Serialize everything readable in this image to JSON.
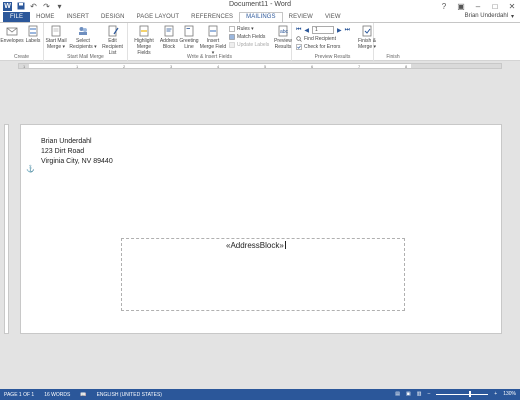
{
  "window": {
    "title": "Document11 - Word",
    "controls": [
      "?",
      "▣",
      "–",
      "□",
      "✕"
    ]
  },
  "qat": {
    "logo": "W",
    "save_icon": "▪",
    "undo_icon": "↶",
    "redo_icon": "↷",
    "more_icon": "▾"
  },
  "tabs": [
    {
      "label": "FILE",
      "kind": "file"
    },
    {
      "label": "HOME",
      "kind": ""
    },
    {
      "label": "INSERT",
      "kind": ""
    },
    {
      "label": "DESIGN",
      "kind": ""
    },
    {
      "label": "PAGE LAYOUT",
      "kind": ""
    },
    {
      "label": "REFERENCES",
      "kind": ""
    },
    {
      "label": "MAILINGS",
      "kind": "active"
    },
    {
      "label": "REVIEW",
      "kind": ""
    },
    {
      "label": "VIEW",
      "kind": ""
    }
  ],
  "user": {
    "name": "Brian Underdahl",
    "dropdown": "▾"
  },
  "ribbon": {
    "create": {
      "label": "Create",
      "envelopes": "Envelopes",
      "labels": "Labels"
    },
    "start": {
      "label": "Start Mail Merge",
      "start_btn": "Start Mail Merge ▾",
      "select_btn": "Select Recipients ▾",
      "edit_btn": "Edit Recipient List"
    },
    "write": {
      "label": "Write & Insert Fields",
      "highlight": "Highlight Merge Fields",
      "address": "Address Block",
      "greeting": "Greeting Line",
      "insert_merge": "Insert Merge Field ▾",
      "rules": "Rules ▾",
      "match": "Match Fields",
      "update": "Update Labels"
    },
    "preview": {
      "label": "Preview Results",
      "preview_btn": "Preview Results",
      "record": "1",
      "find": "Find Recipient",
      "check": "Check for Errors"
    },
    "finish": {
      "label": "Finish",
      "finish_btn": "Finish & Merge ▾"
    }
  },
  "ruler": {
    "ticks": [
      "1",
      "1",
      "2",
      "3",
      "4",
      "5",
      "6",
      "7",
      "8"
    ]
  },
  "document": {
    "return_address": [
      "Brian Underdahl",
      "123 Dirt Road",
      "Virginia City, NV 89440"
    ],
    "merge_field": "«AddressBlock»",
    "anchor": "⚓"
  },
  "status": {
    "page": "PAGE 1 OF 1",
    "words": "16 WORDS",
    "language": "ENGLISH (UNITED STATES)",
    "zoom_minus": "–",
    "zoom_plus": "+",
    "zoom": "130%",
    "zoom_level_fraction": 0.62
  },
  "colors": {
    "accent": "#2b579a"
  }
}
